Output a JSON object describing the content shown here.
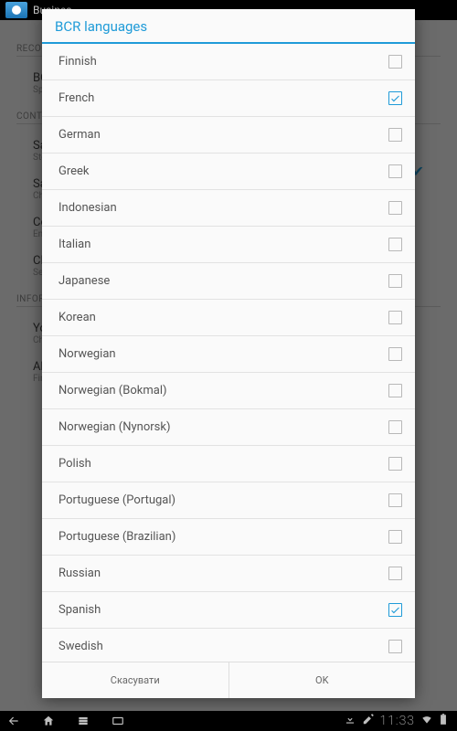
{
  "statusbar": {
    "title": "Busines"
  },
  "bg": {
    "section1": "RECOGNITION",
    "row1": {
      "ttl": "BCR",
      "sub": "Spec"
    },
    "section2": "CONTACTS",
    "row2": {
      "ttl": "Sav",
      "sub": "Stor"
    },
    "row3": {
      "ttl": "Sav",
      "sub": "Cho"
    },
    "row4": {
      "ttl": "Cor",
      "sub": "Ente"
    },
    "row5": {
      "ttl": "CRM",
      "sub": "Set"
    },
    "section3": "INFORMATION",
    "row6": {
      "ttl": "You",
      "sub": "Cho"
    },
    "row7": {
      "ttl": "Abo",
      "sub": "Find"
    }
  },
  "dialog": {
    "title": "BCR languages",
    "items": [
      {
        "label": "Finnish",
        "checked": false
      },
      {
        "label": "French",
        "checked": true
      },
      {
        "label": "German",
        "checked": false
      },
      {
        "label": "Greek",
        "checked": false
      },
      {
        "label": "Indonesian",
        "checked": false
      },
      {
        "label": "Italian",
        "checked": false
      },
      {
        "label": "Japanese",
        "checked": false
      },
      {
        "label": "Korean",
        "checked": false
      },
      {
        "label": "Norwegian",
        "checked": false
      },
      {
        "label": "Norwegian (Bokmal)",
        "checked": false
      },
      {
        "label": "Norwegian (Nynorsk)",
        "checked": false
      },
      {
        "label": "Polish",
        "checked": false
      },
      {
        "label": "Portuguese (Portugal)",
        "checked": false
      },
      {
        "label": "Portuguese (Brazilian)",
        "checked": false
      },
      {
        "label": "Russian",
        "checked": false
      },
      {
        "label": "Spanish",
        "checked": true
      },
      {
        "label": "Swedish",
        "checked": false
      }
    ],
    "cancel": "Скасувати",
    "ok": "OK"
  },
  "navbar": {
    "time": "11:33"
  }
}
